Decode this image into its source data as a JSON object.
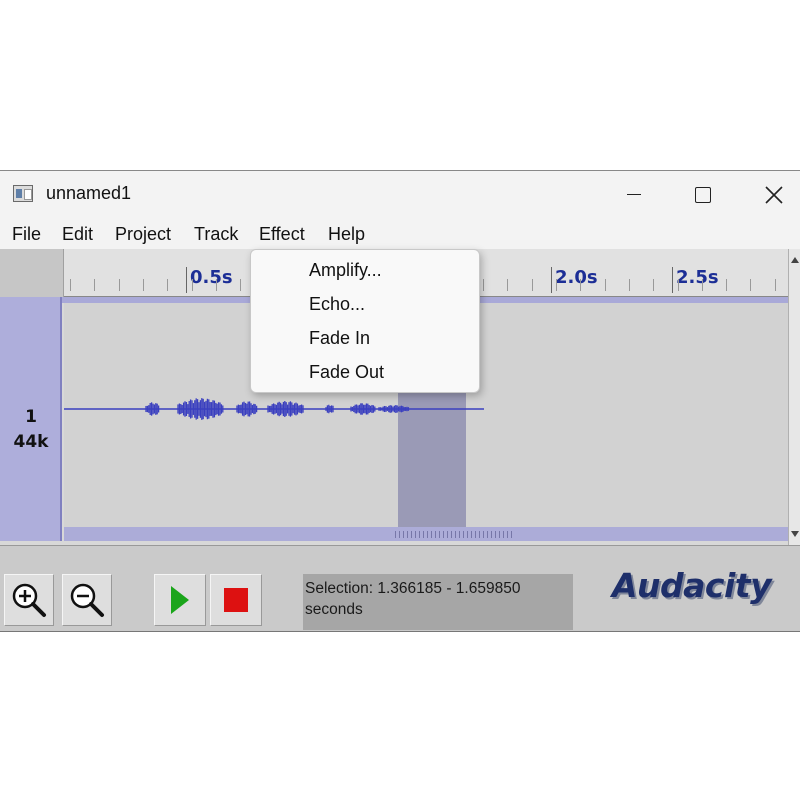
{
  "window": {
    "title": "unnamed1",
    "controls": {
      "minimize": "minimize-icon",
      "maximize": "maximize-icon",
      "close": "close-icon"
    }
  },
  "menu": {
    "items": [
      {
        "label": "File"
      },
      {
        "label": "Edit"
      },
      {
        "label": "Project"
      },
      {
        "label": "Track"
      },
      {
        "label": "Effect"
      },
      {
        "label": "Help"
      }
    ]
  },
  "dropdown": {
    "parent": "Effect",
    "items": [
      {
        "label": "Amplify..."
      },
      {
        "label": "Echo..."
      },
      {
        "label": "Fade In"
      },
      {
        "label": "Fade Out"
      }
    ]
  },
  "ruler": {
    "labels": [
      "0.5s",
      "2.0s",
      "2.5s"
    ]
  },
  "track": {
    "number": "1",
    "rate": "44k"
  },
  "toolbar": {
    "zoom_in_icon": "zoom-in-icon",
    "zoom_out_icon": "zoom-out-icon",
    "play_icon": "play-icon",
    "stop_icon": "stop-icon"
  },
  "status": {
    "selection_line1": "Selection: 1.366185 - 1.659850",
    "selection_line2": "seconds"
  },
  "brand": {
    "logo_text": "Audacity"
  },
  "colors": {
    "waveform": "#3a3fbf",
    "ruler_label": "#1c2e96",
    "track_label_bg": "#aeaedb",
    "selection": "#9a9ab6",
    "play": "#1aa51a",
    "stop": "#dd1111"
  }
}
